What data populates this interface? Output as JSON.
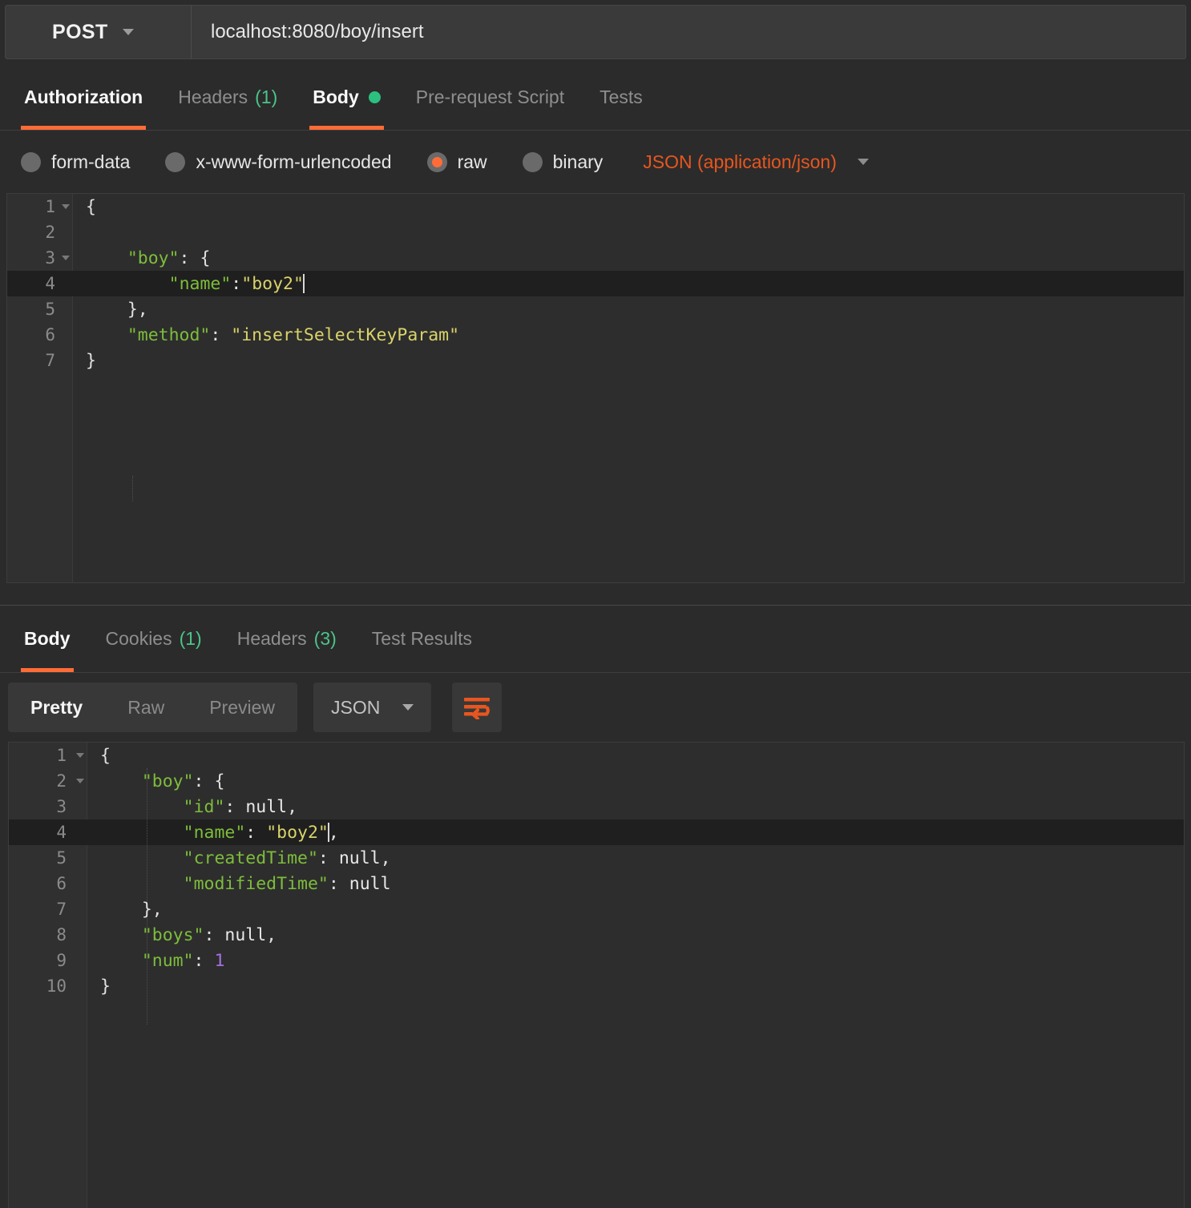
{
  "request": {
    "method": "POST",
    "url": "localhost:8080/boy/insert",
    "tabs": [
      {
        "label": "Authorization",
        "count": "",
        "active": false
      },
      {
        "label": "Headers",
        "count": "(1)",
        "active": false
      },
      {
        "label": "Body",
        "count": "",
        "active": true,
        "dot": true
      },
      {
        "label": "Pre-request Script",
        "count": "",
        "active": false
      },
      {
        "label": "Tests",
        "count": "",
        "active": false
      }
    ],
    "body_types": [
      {
        "label": "form-data",
        "selected": false
      },
      {
        "label": "x-www-form-urlencoded",
        "selected": false
      },
      {
        "label": "raw",
        "selected": true
      },
      {
        "label": "binary",
        "selected": false
      }
    ],
    "content_type": "JSON (application/json)",
    "body_lines": [
      {
        "n": "1",
        "fold": true,
        "active": false,
        "text": "{"
      },
      {
        "n": "2",
        "fold": false,
        "active": false,
        "text": ""
      },
      {
        "n": "3",
        "fold": true,
        "active": false,
        "text": "    \"boy\": {"
      },
      {
        "n": "4",
        "fold": false,
        "active": true,
        "text": "        \"name\":\"boy2\""
      },
      {
        "n": "5",
        "fold": false,
        "active": false,
        "text": "    },"
      },
      {
        "n": "6",
        "fold": false,
        "active": false,
        "text": "    \"method\": \"insertSelectKeyParam\""
      },
      {
        "n": "7",
        "fold": false,
        "active": false,
        "text": "}"
      }
    ]
  },
  "response": {
    "tabs": [
      {
        "label": "Body",
        "count": "",
        "active": true
      },
      {
        "label": "Cookies",
        "count": "(1)",
        "active": false
      },
      {
        "label": "Headers",
        "count": "(3)",
        "active": false
      },
      {
        "label": "Test Results",
        "count": "",
        "active": false
      }
    ],
    "view_modes": [
      {
        "label": "Pretty",
        "active": true
      },
      {
        "label": "Raw",
        "active": false
      },
      {
        "label": "Preview",
        "active": false
      }
    ],
    "format": "JSON",
    "wrap_icon": "word-wrap-icon",
    "body_lines": [
      {
        "n": "1",
        "fold": true,
        "active": false,
        "text": "{"
      },
      {
        "n": "2",
        "fold": true,
        "active": false,
        "text": "    \"boy\": {"
      },
      {
        "n": "3",
        "fold": false,
        "active": false,
        "text": "        \"id\": null,"
      },
      {
        "n": "4",
        "fold": false,
        "active": true,
        "text": "        \"name\": \"boy2\","
      },
      {
        "n": "5",
        "fold": false,
        "active": false,
        "text": "        \"createdTime\": null,"
      },
      {
        "n": "6",
        "fold": false,
        "active": false,
        "text": "        \"modifiedTime\": null"
      },
      {
        "n": "7",
        "fold": false,
        "active": false,
        "text": "    },"
      },
      {
        "n": "8",
        "fold": false,
        "active": false,
        "text": "    \"boys\": null,"
      },
      {
        "n": "9",
        "fold": false,
        "active": false,
        "text": "    \"num\": 1"
      },
      {
        "n": "10",
        "fold": false,
        "active": false,
        "text": "}"
      }
    ]
  },
  "colors": {
    "accent": "#ff6c37",
    "accent_text": "#e8561f",
    "green_count": "#4cc38a",
    "status_dot": "#2bc07f",
    "json_key": "#7dbd3b",
    "json_string": "#d9d36a",
    "json_number": "#a371e0",
    "background": "#2b2b2b",
    "editor_background": "#2d2d2d"
  }
}
